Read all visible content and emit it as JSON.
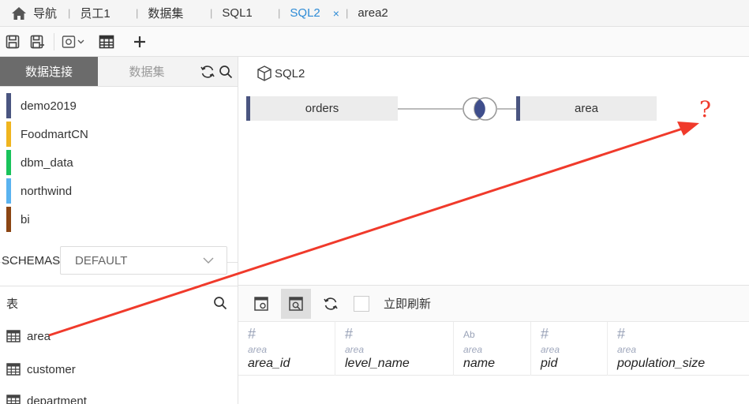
{
  "tabs": [
    {
      "label": "导航",
      "icon": "home-icon"
    },
    {
      "label": "员工1"
    },
    {
      "label": "数据集"
    },
    {
      "label": "SQL1"
    },
    {
      "label": "SQL2",
      "active": true
    },
    {
      "label": "area2"
    }
  ],
  "close_symbol": "×",
  "left_panel": {
    "tab_connections": "数据连接",
    "tab_datasets": "数据集",
    "connections": [
      {
        "name": "demo2019",
        "color": "#4a5580"
      },
      {
        "name": "FoodmartCN",
        "color": "#f0b51f"
      },
      {
        "name": "dbm_data",
        "color": "#19c35b"
      },
      {
        "name": "northwind",
        "color": "#5ab3f0"
      },
      {
        "name": "bi",
        "color": "#8b4513"
      }
    ],
    "schemas_label": "SCHEMAS",
    "schema_value": "DEFAULT",
    "tables_label": "表",
    "tables": [
      "area",
      "customer",
      "department"
    ]
  },
  "canvas": {
    "title": "SQL2",
    "left_node": "orders",
    "right_node": "area",
    "annotation": "?"
  },
  "pane": {
    "refresh_label": "立即刷新",
    "columns": [
      {
        "type_icon": "#",
        "source": "area",
        "name": "area_id"
      },
      {
        "type_icon": "#",
        "source": "area",
        "name": "level_name"
      },
      {
        "type_icon": "Ab",
        "source": "area",
        "name": "name"
      },
      {
        "type_icon": "#",
        "source": "area",
        "name": "pid"
      },
      {
        "type_icon": "#",
        "source": "area",
        "name": "population_size"
      }
    ]
  },
  "colors": {
    "accent": "#2d8bd6",
    "annotation_red": "#f03a2b",
    "node_edge": "#4a5580"
  }
}
